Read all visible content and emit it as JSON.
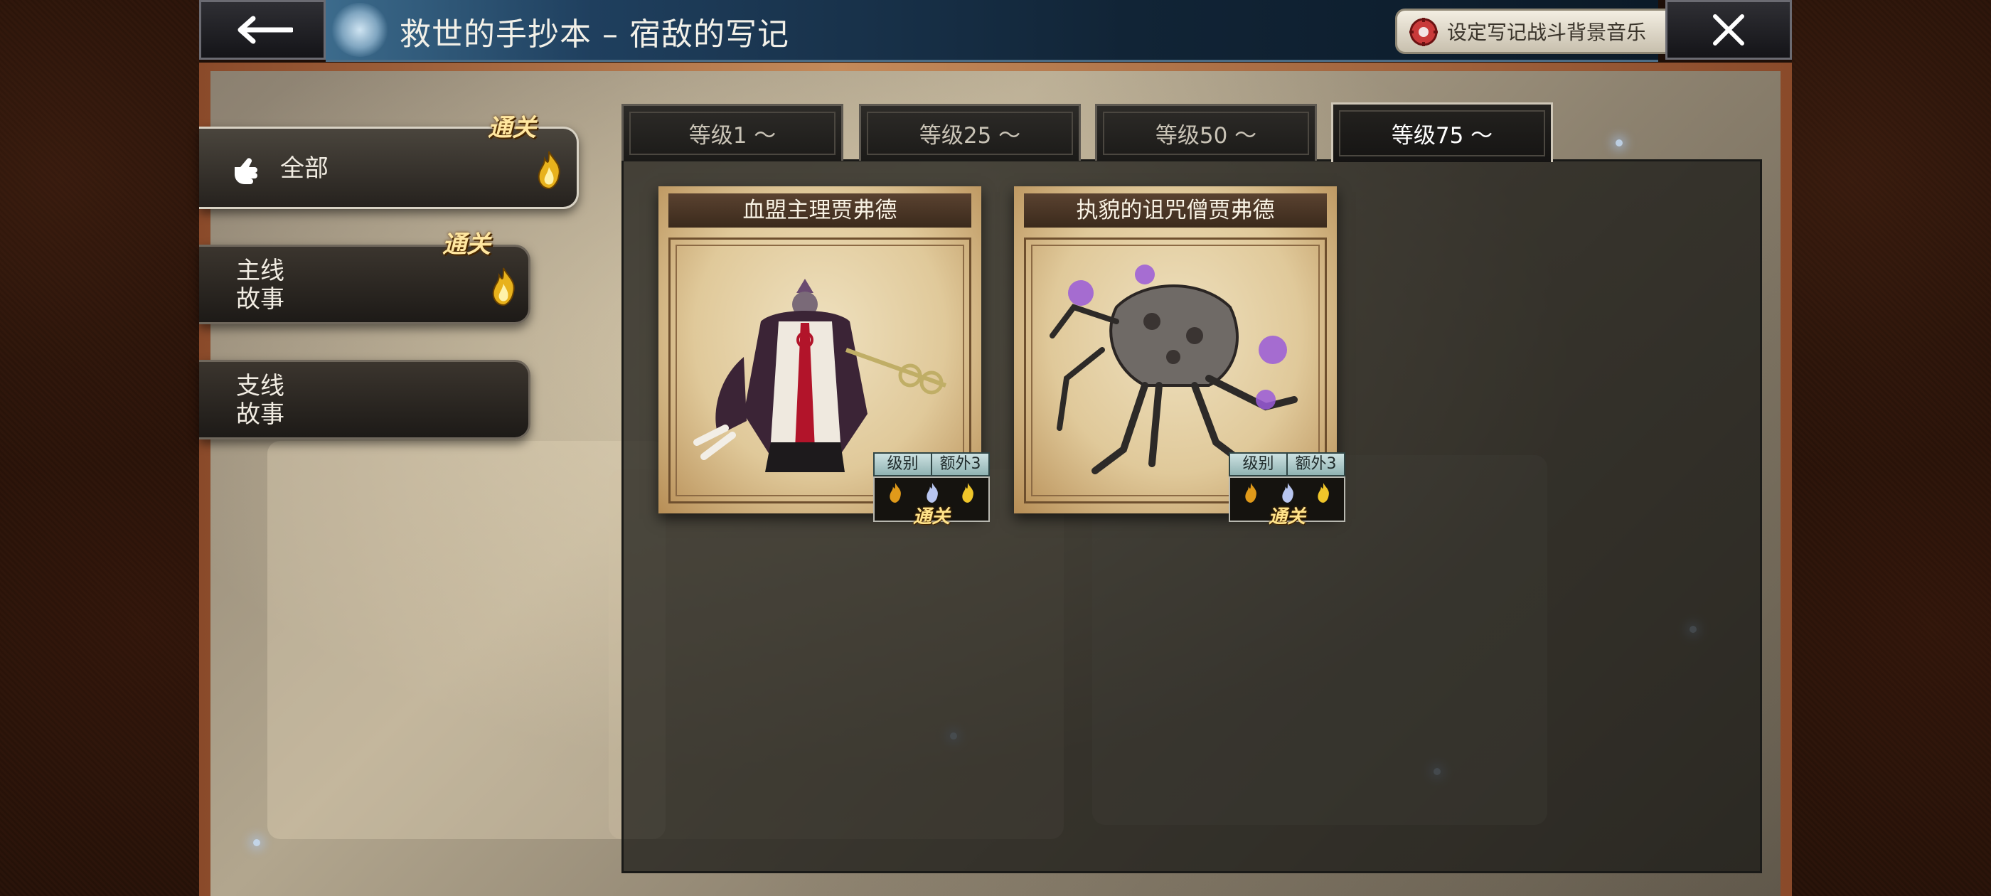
{
  "header": {
    "title": "救世的手抄本 – 宿敌的写记",
    "bgm_button_label": "设定写记战斗背景音乐"
  },
  "nav": {
    "items": [
      {
        "label": "全部",
        "status": "通关",
        "active": true
      },
      {
        "label": "主线\n故事",
        "status": "通关",
        "active": false
      },
      {
        "label": "支线\n故事",
        "status": "",
        "active": false
      }
    ]
  },
  "tabs": [
    {
      "label": "等级1 〜",
      "active": false
    },
    {
      "label": "等级25 〜",
      "active": false
    },
    {
      "label": "等级50 〜",
      "active": false
    },
    {
      "label": "等级75 〜",
      "active": true
    }
  ],
  "cards": [
    {
      "title": "血盟主理贾弗德",
      "badge_level_label": "级别",
      "badge_extra_label": "额外3",
      "badge_status": "通关",
      "icons": [
        "fire-icon",
        "ice-icon",
        "lightning-icon"
      ]
    },
    {
      "title": "执貌的诅咒僧贾弗德",
      "badge_level_label": "级别",
      "badge_extra_label": "额外3",
      "badge_status": "通关",
      "icons": [
        "fire-icon",
        "ice-icon",
        "lightning-icon"
      ]
    }
  ],
  "colors": {
    "accent_gold": "#ffe7a0",
    "title_bar_blue": "#1f3f5e",
    "tab_active_text": "#ffffff"
  }
}
